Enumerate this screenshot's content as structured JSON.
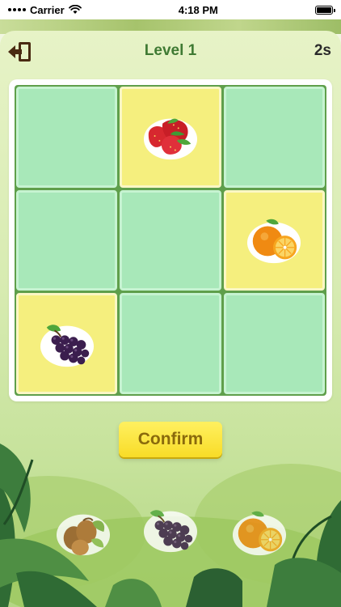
{
  "status_bar": {
    "carrier": "Carrier",
    "time": "4:18 PM"
  },
  "header": {
    "level_title": "Level 1",
    "timer": "2s",
    "exit_icon": "exit-door-icon"
  },
  "board": {
    "rows": 3,
    "cols": 3,
    "cells": [
      {
        "state": "empty",
        "fruit": ""
      },
      {
        "state": "filled",
        "fruit": "strawberry"
      },
      {
        "state": "empty",
        "fruit": ""
      },
      {
        "state": "empty",
        "fruit": ""
      },
      {
        "state": "empty",
        "fruit": ""
      },
      {
        "state": "filled",
        "fruit": "orange"
      },
      {
        "state": "filled",
        "fruit": "grapes"
      },
      {
        "state": "empty",
        "fruit": ""
      },
      {
        "state": "empty",
        "fruit": ""
      }
    ]
  },
  "confirm": {
    "label": "Confirm"
  },
  "pieces": [
    {
      "fruit": "hazelnut"
    },
    {
      "fruit": "grapes"
    },
    {
      "fruit": "orange"
    }
  ],
  "colors": {
    "title_green": "#3f7a33",
    "empty_cell": "#a8e8b9",
    "filled_cell": "#f5ef7e",
    "grid_green": "#5f9f4b",
    "confirm_yellow": "#f8dc27"
  }
}
